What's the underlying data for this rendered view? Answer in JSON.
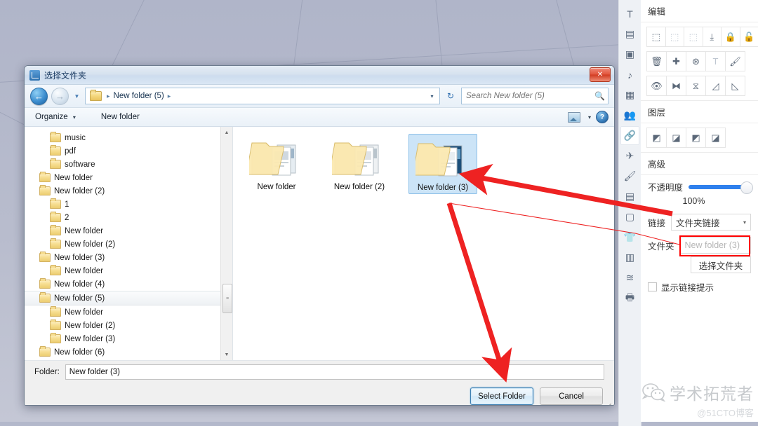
{
  "desktop": {
    "bg_color": "#b3b8cb"
  },
  "dialog": {
    "title": "选择文件夹",
    "close_label": "✕",
    "address": {
      "crumb_root": "New folder (5)",
      "sep": "▸",
      "dropdown": "▾",
      "refresh": "↻"
    },
    "search": {
      "placeholder": "Search New folder (5)",
      "value": ""
    },
    "toolbar": {
      "organize": "Organize",
      "organize_caret": "▾",
      "new_folder": "New folder",
      "view_caret": "▾",
      "help": "?"
    },
    "tree": [
      {
        "label": "music",
        "indent": 2,
        "selected": false
      },
      {
        "label": "pdf",
        "indent": 2,
        "selected": false
      },
      {
        "label": "software",
        "indent": 2,
        "selected": false
      },
      {
        "label": "New folder",
        "indent": 1,
        "selected": false
      },
      {
        "label": "New folder (2)",
        "indent": 1,
        "selected": false
      },
      {
        "label": "1",
        "indent": 2,
        "selected": false
      },
      {
        "label": "2",
        "indent": 2,
        "selected": false
      },
      {
        "label": "New folder",
        "indent": 2,
        "selected": false
      },
      {
        "label": "New folder (2)",
        "indent": 2,
        "selected": false
      },
      {
        "label": "New folder (3)",
        "indent": 1,
        "selected": false
      },
      {
        "label": "New folder",
        "indent": 2,
        "selected": false
      },
      {
        "label": "New folder (4)",
        "indent": 1,
        "selected": false
      },
      {
        "label": "New folder (5)",
        "indent": 1,
        "selected": true
      },
      {
        "label": "New folder",
        "indent": 2,
        "selected": false
      },
      {
        "label": "New folder (2)",
        "indent": 2,
        "selected": false
      },
      {
        "label": "New folder (3)",
        "indent": 2,
        "selected": false
      },
      {
        "label": "New folder (6)",
        "indent": 1,
        "selected": false
      }
    ],
    "scroll": {
      "up": "▲",
      "down": "▼",
      "thumb": "≡"
    },
    "files": [
      {
        "label": "New folder",
        "selected": false
      },
      {
        "label": "New folder (2)",
        "selected": false
      },
      {
        "label": "New folder (3)",
        "selected": true
      }
    ],
    "footer": {
      "folder_label": "Folder:",
      "folder_value": "New folder (3)",
      "select_button": "Select Folder",
      "cancel_button": "Cancel"
    }
  },
  "toolcol": [
    {
      "name": "text-tool",
      "glyph": "T",
      "active": false
    },
    {
      "name": "callout-tool",
      "glyph": "▤",
      "active": false
    },
    {
      "name": "video-tool",
      "glyph": "▣",
      "active": false
    },
    {
      "name": "audio-tool",
      "glyph": "♪",
      "active": false
    },
    {
      "name": "chart-tool",
      "glyph": "▦",
      "active": false
    },
    {
      "name": "people-tool",
      "glyph": "👥",
      "active": false
    },
    {
      "name": "link-tool",
      "glyph": "🔗",
      "active": true
    },
    {
      "name": "plane-tool",
      "glyph": "✈",
      "active": false
    },
    {
      "name": "brush-tool",
      "glyph": "🖌",
      "active": false
    },
    {
      "name": "form-tool",
      "glyph": "▤",
      "active": false
    },
    {
      "name": "image-tool",
      "glyph": "▢",
      "active": false
    },
    {
      "name": "shirt-tool",
      "glyph": "👕",
      "active": false
    },
    {
      "name": "columns-tool",
      "glyph": "▥",
      "active": false
    },
    {
      "name": "layers-tool",
      "glyph": "≋",
      "active": false
    },
    {
      "name": "print-tool",
      "glyph": "🖶",
      "active": false
    }
  ],
  "panel": {
    "edit": {
      "title": "编辑",
      "row1": [
        {
          "name": "group-icon",
          "glyph": "⬚",
          "dim": false
        },
        {
          "name": "ungroup-icon",
          "glyph": "⬚",
          "dim": true
        },
        {
          "name": "select-all-icon",
          "glyph": "⬚",
          "dim": true
        },
        {
          "name": "save-to-box-icon",
          "glyph": "⤓",
          "dim": false
        },
        {
          "name": "lock-icon",
          "glyph": "🔒",
          "dim": false
        },
        {
          "name": "unlock-icon",
          "glyph": "🔓",
          "dim": true
        }
      ],
      "row2": [
        {
          "name": "delete-icon",
          "glyph": "🗑",
          "dim": false
        },
        {
          "name": "add-icon",
          "glyph": "✚",
          "dim": false
        },
        {
          "name": "reset-icon",
          "glyph": "⊛",
          "dim": false
        },
        {
          "name": "text-icon",
          "glyph": "T",
          "dim": true
        },
        {
          "name": "format-brush-icon",
          "glyph": "🖌",
          "dim": false
        }
      ],
      "row3": [
        {
          "name": "visibility-icon",
          "glyph": "👁",
          "dim": false
        },
        {
          "name": "flip-horizontal-icon",
          "glyph": "⧓",
          "dim": false
        },
        {
          "name": "flip-vertical-icon",
          "glyph": "⧖",
          "dim": false
        },
        {
          "name": "align-left-icon",
          "glyph": "◿",
          "dim": false
        },
        {
          "name": "align-right-icon",
          "glyph": "◺",
          "dim": false
        }
      ]
    },
    "layer": {
      "title": "图层",
      "buttons": [
        {
          "name": "bring-to-front-icon",
          "glyph": "◩"
        },
        {
          "name": "send-to-back-icon",
          "glyph": "◪"
        },
        {
          "name": "bring-forward-icon",
          "glyph": "◩"
        },
        {
          "name": "send-backward-icon",
          "glyph": "◪"
        }
      ]
    },
    "advanced": {
      "title": "高级",
      "opacity_label": "不透明度",
      "opacity_value": "100%",
      "opacity_percent": 100,
      "link_label": "链接",
      "link_value": "文件夹链接",
      "link_caret": "▾",
      "folder_label": "文件夹",
      "folder_placeholder": "New folder (3)",
      "choose_button": "选择文件夹",
      "hint_checkbox_label": "显示链接提示",
      "hint_checked": false
    }
  },
  "annotations": {
    "highlight_color": "#ff0000",
    "arrow_color": "#ee2222"
  },
  "watermark": {
    "name": "学术拓荒者",
    "sub": "@51CTO博客"
  }
}
